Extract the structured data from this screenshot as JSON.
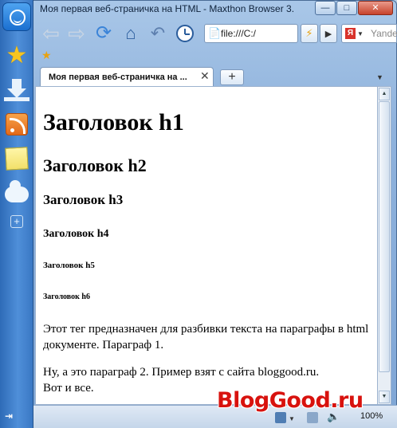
{
  "window": {
    "title": "Моя первая веб-страничка на HTML - Maxthon Browser 3.",
    "minimize_glyph": "—",
    "maximize_glyph": "□",
    "close_glyph": "✕"
  },
  "sidebar": {
    "items": [
      {
        "icon": "maxthon-logo-icon"
      },
      {
        "icon": "favorites-star-icon"
      },
      {
        "icon": "download-icon"
      },
      {
        "icon": "rss-icon"
      },
      {
        "icon": "notes-icon"
      },
      {
        "icon": "cloud-icon"
      },
      {
        "icon": "add-icon",
        "glyph": "+"
      }
    ],
    "collapse_glyph": "⇥"
  },
  "toolbar": {
    "back_glyph": "⇦",
    "forward_glyph": "⇨",
    "refresh_glyph": "⟳",
    "home_glyph": "⌂",
    "undo_glyph": "↶",
    "address": "file:///C:/",
    "address_icon": "📄",
    "lightning_glyph": "⚡",
    "play_glyph": "▶",
    "search_engine_glyph": "Я",
    "search_caret": "▼",
    "search_placeholder": "Yande"
  },
  "favorites_bar": {
    "star_glyph": "★"
  },
  "tabs": [
    {
      "label": "Моя первая веб-страничка на ...",
      "close_glyph": "✕",
      "active": true
    }
  ],
  "new_tab_glyph": "+",
  "tab_menu_glyph": "▼",
  "page": {
    "h1": "Заголовок h1",
    "h2": "Заголовок h2",
    "h3": "Заголовок h3",
    "h4": "Заголовок h4",
    "h5": "Заголовок h5",
    "h6": "Заголовок h6",
    "p1": "Этот тег предназначен для разбивки текста на параграфы в html документе. Параграф 1.",
    "p2_line1": "Ну, а это параграф 2. Пример взят с сайта bloggood.ru.",
    "p2_line2": "Вот и все."
  },
  "scrollbar": {
    "up_glyph": "▲",
    "down_glyph": "▼"
  },
  "statusbar": {
    "watermark": "BlogGood.ru",
    "speaker_glyph": "🔈",
    "zoom": "100%",
    "caret": "▼"
  },
  "colors": {
    "watermark": "#d8120e",
    "sidebar": "#3a78c4",
    "chrome": "#b9d1ea"
  }
}
